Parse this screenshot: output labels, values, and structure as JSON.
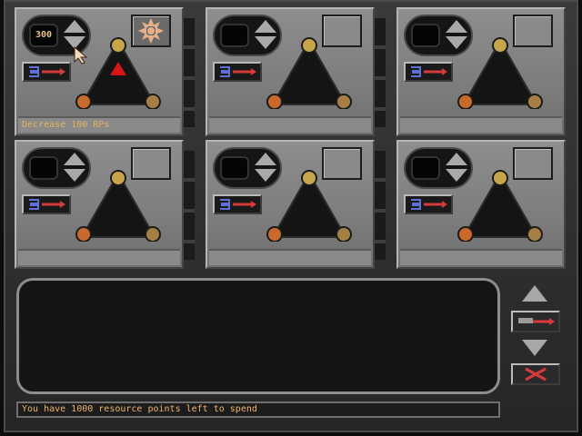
{
  "slots": [
    {
      "value": "300",
      "status": "Decrease 100 RPs"
    },
    {
      "value": "",
      "status": ""
    },
    {
      "value": "",
      "status": ""
    },
    {
      "value": "",
      "status": ""
    },
    {
      "value": "",
      "status": ""
    },
    {
      "value": "",
      "status": ""
    }
  ],
  "footer": {
    "text": "You have 1000 resource points left to spend"
  },
  "icons": {
    "increase": "arrow-up-icon",
    "decrease": "arrow-down-icon",
    "resource_transfer": "money-transfer-icon",
    "triangle_top": "scales-icon",
    "triangle_left": "fire-icon",
    "triangle_right": "tree-icon",
    "selected_item": "flower-emblem-icon",
    "cancel": "cancel-x-icon"
  },
  "colors": {
    "panel": "#8e8e8e",
    "dark": "#151515",
    "text_accent": "#e6b25c",
    "red_marker": "#d61616"
  }
}
